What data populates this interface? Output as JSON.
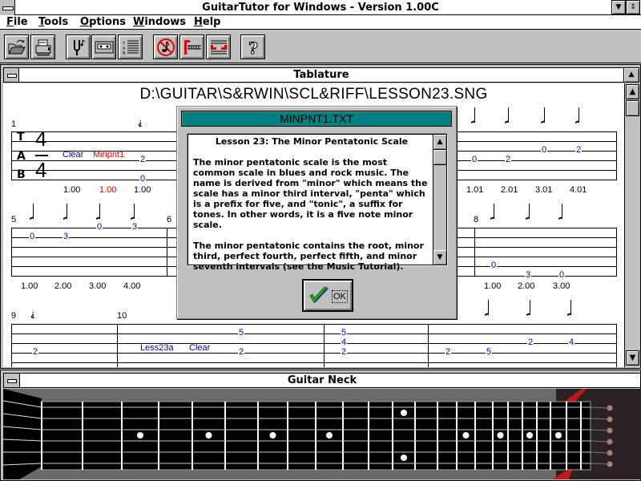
{
  "app": {
    "title": "GuitarTutor for Windows - Version 1.00C"
  },
  "menu": [
    {
      "label": "File",
      "accel": "F"
    },
    {
      "label": "Tools",
      "accel": "T"
    },
    {
      "label": "Options",
      "accel": "O"
    },
    {
      "label": "Windows",
      "accel": "W"
    },
    {
      "label": "Help",
      "accel": "H"
    }
  ],
  "toolbar": {
    "buttons": [
      {
        "name": "open-file",
        "icon": "folder-open-icon"
      },
      {
        "name": "print",
        "icon": "printer-icon"
      },
      {
        "name": "tuner",
        "icon": "tuning-fork-icon"
      },
      {
        "name": "tape-player",
        "icon": "cassette-icon"
      },
      {
        "name": "tab-view",
        "icon": "tab-staff-icon"
      },
      {
        "name": "metronome-off",
        "icon": "no-note-icon"
      },
      {
        "name": "loop-start",
        "icon": "loop-start-icon"
      },
      {
        "name": "loop-range",
        "icon": "loop-range-icon"
      },
      {
        "name": "help",
        "icon": "question-icon"
      }
    ]
  },
  "tablature": {
    "window_title": "Tablature",
    "file_path": "D:\\GUITAR\\S&RWIN\\SCL&RIFF\\LESSON23.SNG",
    "tab_letters": [
      "T",
      "A",
      "B"
    ],
    "time_signature": {
      "top": "4",
      "bottom": "4"
    },
    "measures": {
      "m1": "1",
      "m5": "5",
      "m6": "6",
      "m8": "8",
      "m9": "9",
      "m10": "10"
    },
    "markers": {
      "clear1": "Clear",
      "minpnt1": "Minpnt1",
      "less23a": "Less23a",
      "clear2": "Clear"
    },
    "row1": {
      "frets_left": [
        "2",
        "0"
      ],
      "beats_left": [
        "1.00",
        "1.00",
        "1.00"
      ],
      "frets_right": [
        "0",
        "2",
        "0",
        "2"
      ],
      "beats_right": [
        "1.01",
        "2.01",
        "3.01",
        "4.01"
      ]
    },
    "row2": {
      "frets_left": [
        "0",
        "3",
        "0",
        "3"
      ],
      "beats_left": [
        "1.00",
        "2.00",
        "3.00",
        "4.00"
      ],
      "frets_right": [
        "0",
        "3",
        "0"
      ],
      "beats_right": [
        "1.00",
        "2.00",
        "3.00"
      ]
    },
    "row3": {
      "frets_m9": [
        "2"
      ],
      "frets_m10": [
        "5",
        "2"
      ],
      "frets_m11": [
        "5",
        "4",
        "2"
      ],
      "frets_m12": [
        "2",
        "5",
        "2",
        "4"
      ]
    }
  },
  "dialog": {
    "title": "MINPNT1.TXT",
    "heading": "Lesson 23:  The Minor Pentatonic Scale",
    "paragraphs": [
      "The minor pentatonic scale is the most common scale in blues and rock music.  The name is derived from \"minor\" which means the scale has a minor third interval, \"penta\" which is a prefix for five, and \"tonic\", a suffix for tones.  In other words, it is a five note minor scale.",
      "The minor pentatonic contains the root, minor third, perfect fourth, perfect fifth, and minor seventh intervals (see the Music Tutorial)."
    ],
    "ok_label": "OK"
  },
  "neck": {
    "window_title": "Guitar Neck",
    "frets_shown": 22,
    "single_dot_frets": [
      3,
      5,
      7,
      9,
      15,
      17,
      19,
      21
    ],
    "double_dot_frets": [
      12
    ]
  },
  "colors": {
    "dialog_title_bg": "#008080",
    "fret_number": "#0000c0",
    "marker_red": "#e00000",
    "fretboard": "#000000"
  }
}
